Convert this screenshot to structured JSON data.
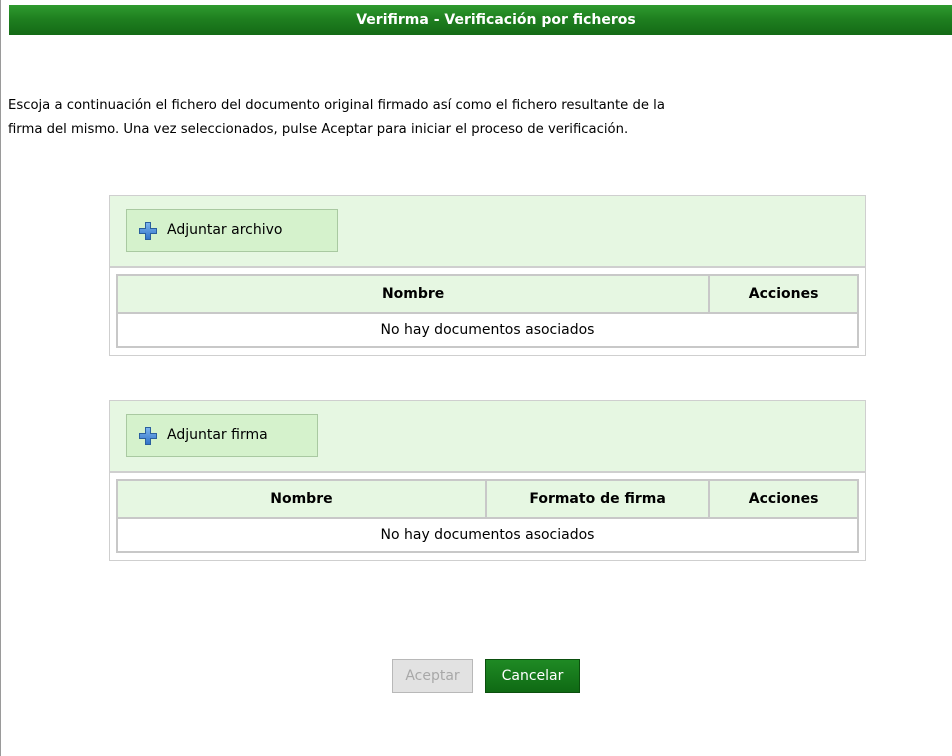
{
  "window": {
    "title": "Verifirma - Verificación por ficheros"
  },
  "intro": {
    "line1": "Escoja a continuación el fichero del documento original firmado así como el fichero resultante de la",
    "line2": "firma del mismo. Una vez seleccionados, pulse Aceptar para iniciar el proceso de verificación."
  },
  "document_panel": {
    "attach_label": "Adjuntar archivo",
    "attach_icon": "plus-icon",
    "columns": [
      "Nombre",
      "Acciones"
    ],
    "empty_message": "No hay documentos asociados"
  },
  "signature_panel": {
    "attach_label": "Adjuntar firma",
    "attach_icon": "plus-icon",
    "columns": [
      "Nombre",
      "Formato de firma",
      "Acciones"
    ],
    "empty_message": "No hay documentos asociados"
  },
  "actions": {
    "accept_label": "Aceptar",
    "accept_enabled": false,
    "cancel_label": "Cancelar"
  },
  "colors": {
    "title_bar": "#1f8020",
    "panel_background": "#e6f7e2",
    "attach_button": "#d5f2cc",
    "cancel_button": "#0f6a14"
  }
}
